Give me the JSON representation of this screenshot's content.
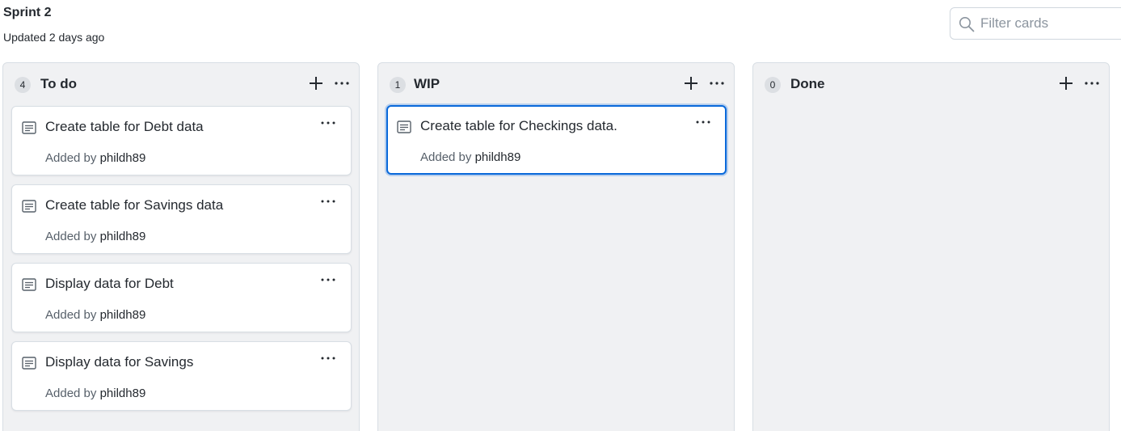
{
  "project": {
    "title": "Sprint 2",
    "updated": "Updated 2 days ago"
  },
  "filter": {
    "placeholder": "Filter cards",
    "value": ""
  },
  "columns": [
    {
      "count": "4",
      "name": "To do",
      "cards": [
        {
          "title": "Create table for Debt data",
          "added_by_label": "Added by",
          "author": "phildh89"
        },
        {
          "title": "Create table for Savings data",
          "added_by_label": "Added by",
          "author": "phildh89"
        },
        {
          "title": "Display data for Debt",
          "added_by_label": "Added by",
          "author": "phildh89"
        },
        {
          "title": "Display data for Savings",
          "added_by_label": "Added by",
          "author": "phildh89"
        }
      ]
    },
    {
      "count": "1",
      "name": "WIP",
      "cards": [
        {
          "title": "Create table for Checkings data.",
          "added_by_label": "Added by",
          "author": "phildh89",
          "selected": true
        }
      ]
    },
    {
      "count": "0",
      "name": "Done",
      "cards": []
    }
  ],
  "colors": {
    "column_bg": "#f0f1f3",
    "card_border": "#d8dee4",
    "selected_border": "#0969da",
    "muted_text": "#57606a"
  },
  "icons": {
    "search": "search-icon",
    "add": "plus-icon",
    "more": "kebab-horizontal-icon",
    "note": "note-icon"
  }
}
